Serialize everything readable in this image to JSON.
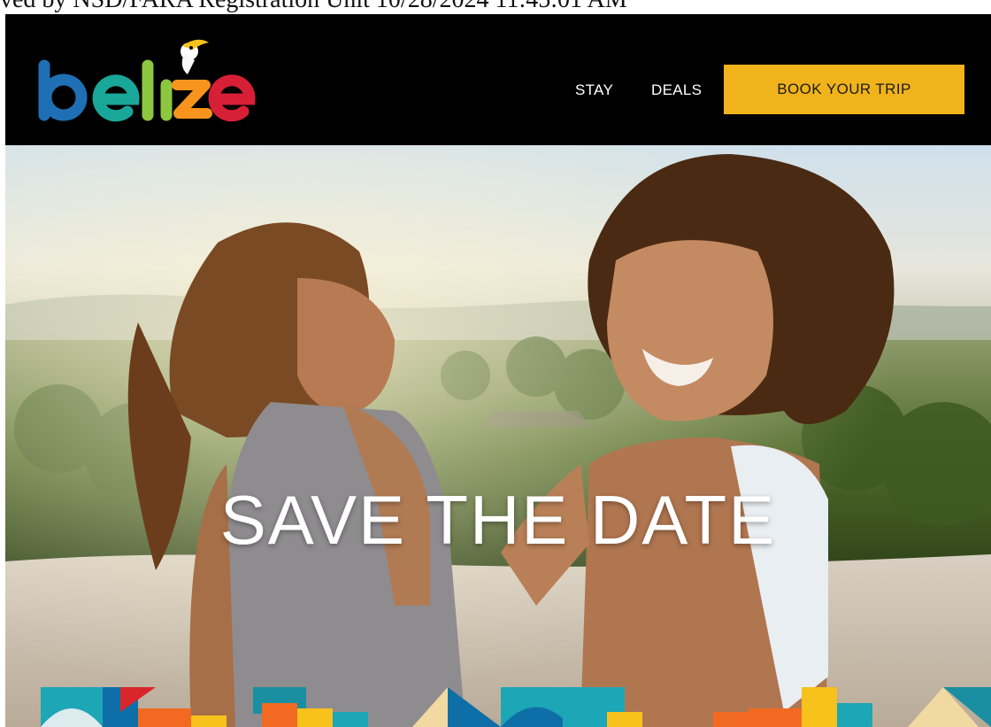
{
  "stamp": {
    "text": "ved by NSD/FARA Registration Unit 10/28/2024 11:45:01 AM"
  },
  "brand": {
    "name": "belize",
    "letter_colors": [
      "#1f6fb5",
      "#19a79a",
      "#8dc63f",
      "#f7941d",
      "#d71f36",
      "#cc2229"
    ]
  },
  "nav": {
    "items": [
      {
        "label": "STAY"
      },
      {
        "label": "DEALS"
      }
    ],
    "cta_label": "BOOK YOUR TRIP",
    "cta_color": "#f0b31b"
  },
  "hero": {
    "title": "SAVE THE DATE",
    "image_alt": "Two people smiling on a Maya temple overlooking jungle",
    "pattern_colors": [
      "#1da6b5",
      "#0e6fa8",
      "#d9262b",
      "#f26a21",
      "#f7c21b",
      "#1a8fa1",
      "#f1d9a2"
    ]
  }
}
